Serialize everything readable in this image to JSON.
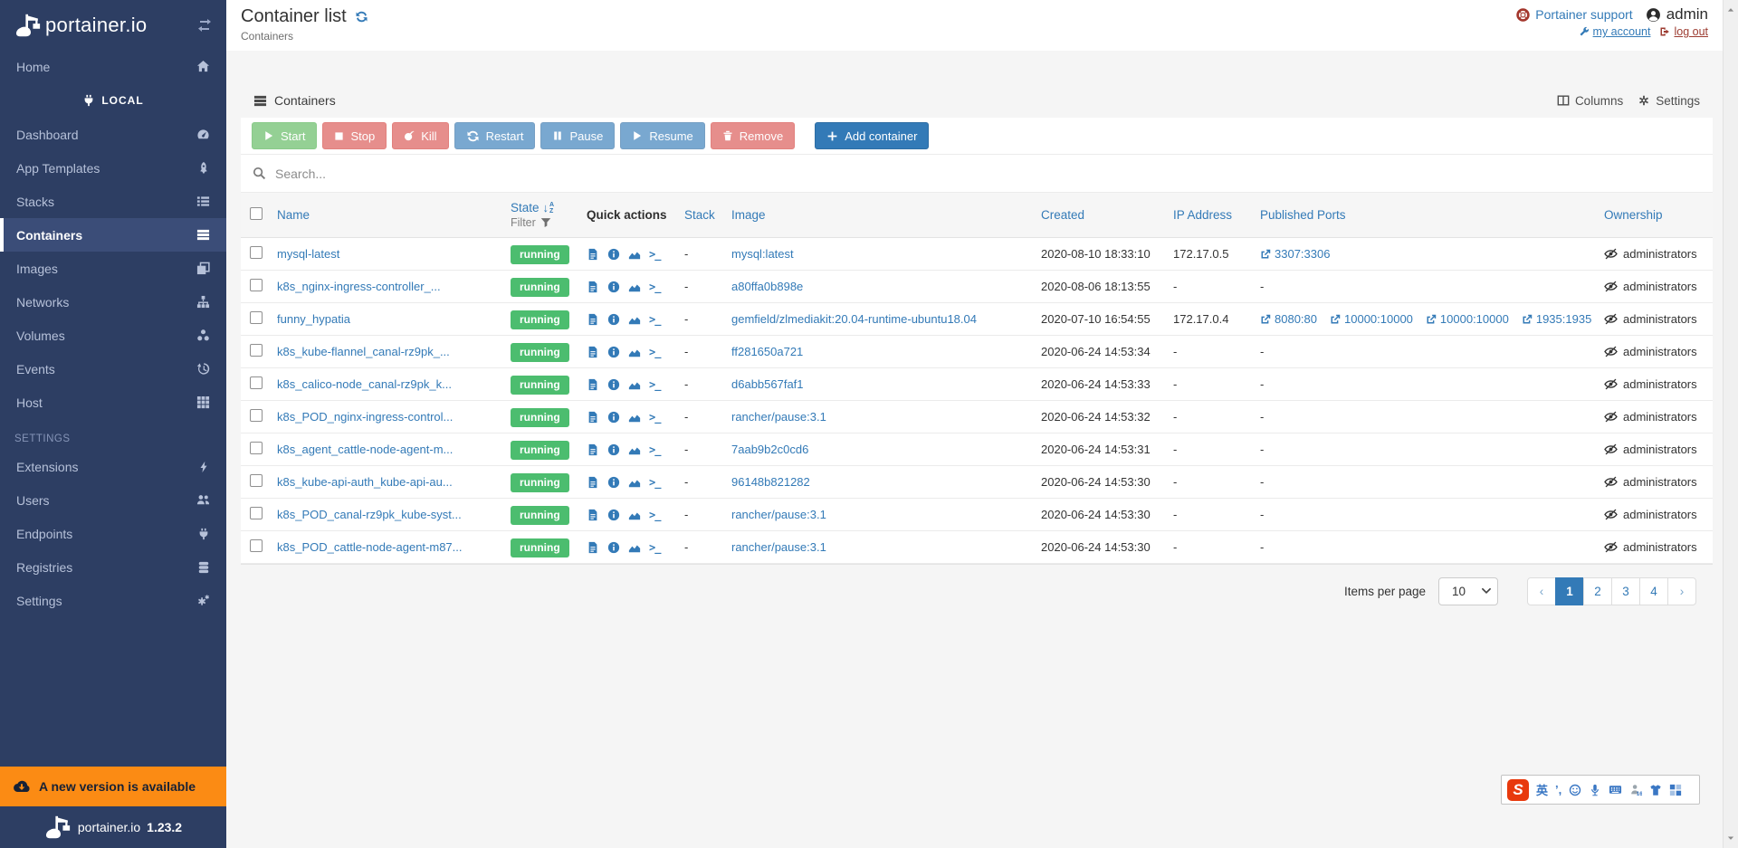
{
  "colors": {
    "sidebar": "#2d3e63",
    "sidebar_active": "#3b4d78",
    "accent_blue": "#337ab7",
    "badge_green": "#4cbd6f",
    "danger_red": "#d9534f",
    "banner_orange": "#fb8b14",
    "page_bg": "#f5f5f5"
  },
  "sidebar": {
    "logo_text": "portainer.io",
    "endpoint": {
      "label": "LOCAL",
      "icon": "plug"
    },
    "main_items": [
      {
        "label": "Home",
        "icon": "home",
        "active": false
      },
      {
        "label": "Dashboard",
        "icon": "dashboard",
        "active": false
      },
      {
        "label": "App Templates",
        "icon": "rocket",
        "active": false
      },
      {
        "label": "Stacks",
        "icon": "stacks",
        "active": false
      },
      {
        "label": "Containers",
        "icon": "containers",
        "active": true
      },
      {
        "label": "Images",
        "icon": "images",
        "active": false
      },
      {
        "label": "Networks",
        "icon": "networks",
        "active": false
      },
      {
        "label": "Volumes",
        "icon": "volumes",
        "active": false
      },
      {
        "label": "Events",
        "icon": "events",
        "active": false
      },
      {
        "label": "Host",
        "icon": "host",
        "active": false
      }
    ],
    "settings_section": "SETTINGS",
    "settings_items": [
      {
        "label": "Extensions",
        "icon": "bolt",
        "active": false
      },
      {
        "label": "Users",
        "icon": "users",
        "active": false
      },
      {
        "label": "Endpoints",
        "icon": "plug",
        "active": false
      },
      {
        "label": "Registries",
        "icon": "registries",
        "active": false
      },
      {
        "label": "Settings",
        "icon": "cogs",
        "active": false
      }
    ],
    "banner_text": "A new version is available",
    "footer_brand": "portainer.io",
    "footer_version": "1.23.2"
  },
  "header": {
    "title": "Container list",
    "breadcrumb": "Containers",
    "support_label": "Portainer support",
    "username": "admin",
    "my_account_label": "my account",
    "log_out_label": "log out"
  },
  "panel": {
    "title": "Containers",
    "columns_label": "Columns",
    "settings_label": "Settings",
    "actions": [
      {
        "label": "Start",
        "style": "success",
        "icon": "play",
        "disabled": true
      },
      {
        "label": "Stop",
        "style": "danger",
        "icon": "stop",
        "disabled": true
      },
      {
        "label": "Kill",
        "style": "danger",
        "icon": "bomb",
        "disabled": true
      },
      {
        "label": "Restart",
        "style": "info",
        "icon": "refresh",
        "disabled": true
      },
      {
        "label": "Pause",
        "style": "info",
        "icon": "pause",
        "disabled": true
      },
      {
        "label": "Resume",
        "style": "info",
        "icon": "play",
        "disabled": true
      },
      {
        "label": "Remove",
        "style": "danger",
        "icon": "trash",
        "disabled": true
      }
    ],
    "add_button_label": "Add container",
    "search_placeholder": "Search...",
    "table": {
      "headers": {
        "name": "Name",
        "state": "State",
        "filter": "Filter",
        "quick_actions": "Quick actions",
        "stack": "Stack",
        "image": "Image",
        "created": "Created",
        "ip": "IP Address",
        "ports": "Published Ports",
        "ownership": "Ownership"
      },
      "rows": [
        {
          "name": "mysql-latest",
          "state": "running",
          "stack": "-",
          "image": "mysql:latest",
          "created": "2020-08-10 18:33:10",
          "ip": "172.17.0.5",
          "ports": [
            "3307:3306"
          ],
          "ownership": "administrators"
        },
        {
          "name": "k8s_nginx-ingress-controller_...",
          "state": "running",
          "stack": "-",
          "image": "a80ffa0b898e",
          "created": "2020-08-06 18:13:55",
          "ip": "-",
          "ports": [],
          "ownership": "administrators"
        },
        {
          "name": "funny_hypatia",
          "state": "running",
          "stack": "-",
          "image": "gemfield/zlmediakit:20.04-runtime-ubuntu18.04",
          "created": "2020-07-10 16:54:55",
          "ip": "172.17.0.4",
          "ports": [
            "8080:80",
            "10000:10000",
            "10000:10000",
            "1935:1935"
          ],
          "ownership": "administrators"
        },
        {
          "name": "k8s_kube-flannel_canal-rz9pk_...",
          "state": "running",
          "stack": "-",
          "image": "ff281650a721",
          "created": "2020-06-24 14:53:34",
          "ip": "-",
          "ports": [],
          "ownership": "administrators"
        },
        {
          "name": "k8s_calico-node_canal-rz9pk_k...",
          "state": "running",
          "stack": "-",
          "image": "d6abb567faf1",
          "created": "2020-06-24 14:53:33",
          "ip": "-",
          "ports": [],
          "ownership": "administrators"
        },
        {
          "name": "k8s_POD_nginx-ingress-control...",
          "state": "running",
          "stack": "-",
          "image": "rancher/pause:3.1",
          "created": "2020-06-24 14:53:32",
          "ip": "-",
          "ports": [],
          "ownership": "administrators"
        },
        {
          "name": "k8s_agent_cattle-node-agent-m...",
          "state": "running",
          "stack": "-",
          "image": "7aab9b2c0cd6",
          "created": "2020-06-24 14:53:31",
          "ip": "-",
          "ports": [],
          "ownership": "administrators"
        },
        {
          "name": "k8s_kube-api-auth_kube-api-au...",
          "state": "running",
          "stack": "-",
          "image": "96148b821282",
          "created": "2020-06-24 14:53:30",
          "ip": "-",
          "ports": [],
          "ownership": "administrators"
        },
        {
          "name": "k8s_POD_canal-rz9pk_kube-syst...",
          "state": "running",
          "stack": "-",
          "image": "rancher/pause:3.1",
          "created": "2020-06-24 14:53:30",
          "ip": "-",
          "ports": [],
          "ownership": "administrators"
        },
        {
          "name": "k8s_POD_cattle-node-agent-m87...",
          "state": "running",
          "stack": "-",
          "image": "rancher/pause:3.1",
          "created": "2020-06-24 14:53:30",
          "ip": "-",
          "ports": [],
          "ownership": "administrators"
        }
      ]
    },
    "pagination": {
      "items_per_page_label": "Items per page",
      "page_size": "10",
      "prev": "‹",
      "next": "›",
      "pages": [
        "1",
        "2",
        "3",
        "4"
      ],
      "active_page": "1"
    }
  },
  "ime": {
    "lang": "英",
    "punct": "’,",
    "person_badge": "16"
  }
}
